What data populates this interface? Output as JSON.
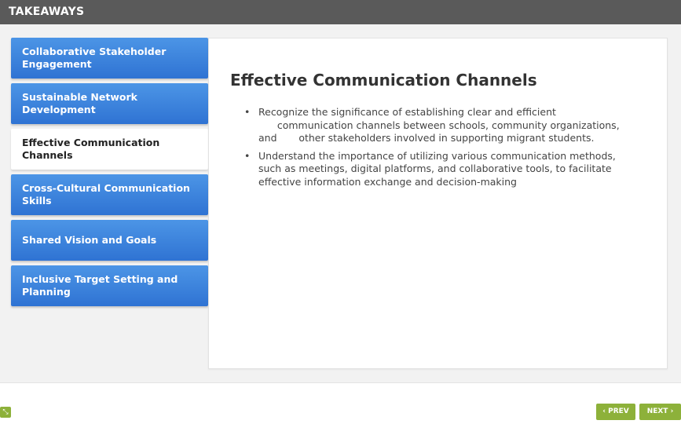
{
  "header": {
    "title": "TAKEAWAYS"
  },
  "tabs": [
    {
      "label": "Collaborative Stakeholder Engagement"
    },
    {
      "label": "Sustainable Network Development"
    },
    {
      "label": "Effective Communication Channels"
    },
    {
      "label": "Cross-Cultural Communication Skills"
    },
    {
      "label": "Shared Vision and Goals"
    },
    {
      "label": "Inclusive Target Setting and Planning"
    }
  ],
  "panel": {
    "title": "Effective Communication Channels",
    "bullets": [
      "Recognize the significance of establishing clear and efficient       communication channels between schools, community organizations, and       other stakeholders involved in supporting migrant students.",
      "Understand the importance of utilizing various communication methods, such as meetings, digital platforms, and collaborative tools, to facilitate effective information exchange and decision-making"
    ]
  },
  "nav": {
    "prev_label": "PREV",
    "next_label": "NEXT",
    "prev_icon": "chevron-left-icon",
    "next_icon": "chevron-right-icon"
  },
  "corner": {
    "icon": "expand-icon"
  },
  "colors": {
    "header_bg": "#5a5a5a",
    "tab_blue": "#3a80db",
    "nav_green": "#8db13a"
  }
}
